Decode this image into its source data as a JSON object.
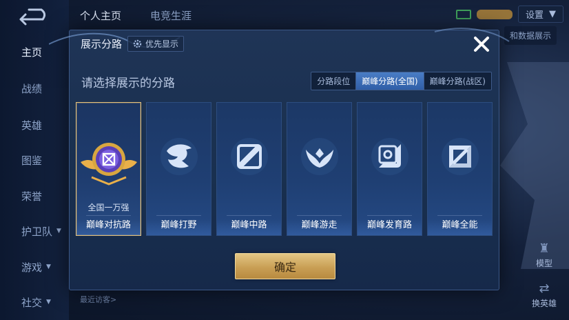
{
  "background": {
    "left_nav": [
      {
        "label": "主页",
        "active": true,
        "has_chevron": false
      },
      {
        "label": "战绩",
        "active": false,
        "has_chevron": false
      },
      {
        "label": "英雄",
        "active": false,
        "has_chevron": false
      },
      {
        "label": "图鉴",
        "active": false,
        "has_chevron": false
      },
      {
        "label": "荣誉",
        "active": false,
        "has_chevron": false
      },
      {
        "label": "护卫队",
        "active": false,
        "has_chevron": true
      },
      {
        "label": "游戏",
        "active": false,
        "has_chevron": true
      },
      {
        "label": "社交",
        "active": false,
        "has_chevron": true
      }
    ],
    "top_tabs": [
      "个人主页",
      "电竞生涯"
    ],
    "settings_label": "设置",
    "side_label": "和数据展示",
    "model_label": "模型",
    "switch_hero_label": "换英雄",
    "visitors_label": "最近访客>"
  },
  "modal": {
    "title": "展示分路",
    "priority_label": "优先显示",
    "subtitle": "请选择展示的分路",
    "segments": [
      {
        "label": "分路段位",
        "active": false
      },
      {
        "label": "巅峰分路(全国)",
        "active": true
      },
      {
        "label": "巅峰分路(战区)",
        "active": false
      }
    ],
    "cards": [
      {
        "label": "巅峰对抗路",
        "rank": "全国一万强",
        "icon": "clash-lane-emblem-icon",
        "selected": true
      },
      {
        "label": "巅峰打野",
        "rank": "",
        "icon": "jungle-dragon-icon",
        "selected": false
      },
      {
        "label": "巅峰中路",
        "rank": "",
        "icon": "mid-lane-icon",
        "selected": false
      },
      {
        "label": "巅峰游走",
        "rank": "",
        "icon": "roam-wings-icon",
        "selected": false
      },
      {
        "label": "巅峰发育路",
        "rank": "",
        "icon": "farm-lane-icon",
        "selected": false
      },
      {
        "label": "巅峰全能",
        "rank": "",
        "icon": "all-round-icon",
        "selected": false
      }
    ],
    "confirm_label": "确定"
  },
  "colors": {
    "accent_gold": "#e6c27a",
    "active_tab_blue": "#3a6ab4",
    "modal_bg": "#1c3153"
  }
}
